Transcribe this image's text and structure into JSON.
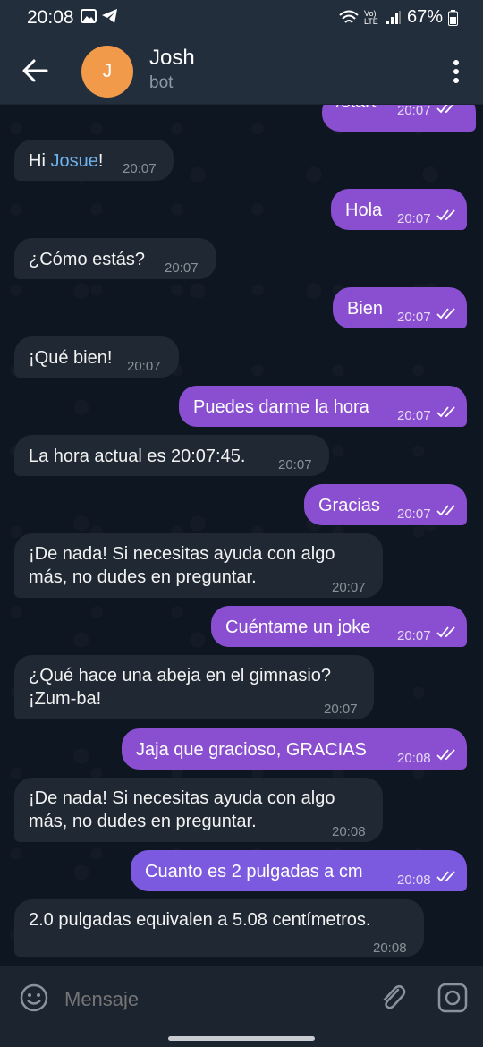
{
  "status_bar": {
    "time": "20:08",
    "battery": "67%",
    "network": "Vo) LTE"
  },
  "header": {
    "avatar_letter": "J",
    "name": "Josh",
    "subtitle": "bot"
  },
  "messages": [
    {
      "dir": "out",
      "text": "/start",
      "time": "20:07"
    },
    {
      "dir": "in",
      "text_pre": "Hi ",
      "mention": "Josue",
      "text_post": "!",
      "time": "20:07"
    },
    {
      "dir": "out",
      "text": "Hola",
      "time": "20:07"
    },
    {
      "dir": "in",
      "text": "¿Cómo estás?",
      "time": "20:07"
    },
    {
      "dir": "out",
      "text": "Bien",
      "time": "20:07"
    },
    {
      "dir": "in",
      "text": "¡Qué bien!",
      "time": "20:07"
    },
    {
      "dir": "out",
      "text": "Puedes darme la hora",
      "time": "20:07"
    },
    {
      "dir": "in",
      "text": "La hora actual es 20:07:45.",
      "time": "20:07"
    },
    {
      "dir": "out",
      "text": "Gracias",
      "time": "20:07"
    },
    {
      "dir": "in",
      "text": "¡De nada! Si necesitas ayuda con algo\nmás, no dudes en preguntar.",
      "time": "20:07"
    },
    {
      "dir": "out",
      "text": "Cuéntame un joke",
      "time": "20:07"
    },
    {
      "dir": "in",
      "text": "¿Qué hace una abeja en el gimnasio?\n¡Zum-ba!",
      "time": "20:07"
    },
    {
      "dir": "out",
      "text": "Jaja que gracioso, GRACIAS",
      "time": "20:08"
    },
    {
      "dir": "in",
      "text": "¡De nada! Si necesitas ayuda con algo\nmás, no dudes en preguntar.",
      "time": "20:08"
    },
    {
      "dir": "out",
      "text": "Cuanto es 2 pulgadas a cm",
      "time": "20:08"
    },
    {
      "dir": "in",
      "text": "2.0 pulgadas equivalen a 5.08 centímetros.",
      "time": "20:08"
    }
  ],
  "composer": {
    "placeholder": "Mensaje"
  },
  "colors": {
    "outgoing_bubble": "#8a4fd0",
    "incoming_bubble": "#1f2833",
    "header_bg": "#232e3c",
    "avatar_bg": "#f19a4a",
    "mention": "#6fb3ee"
  }
}
